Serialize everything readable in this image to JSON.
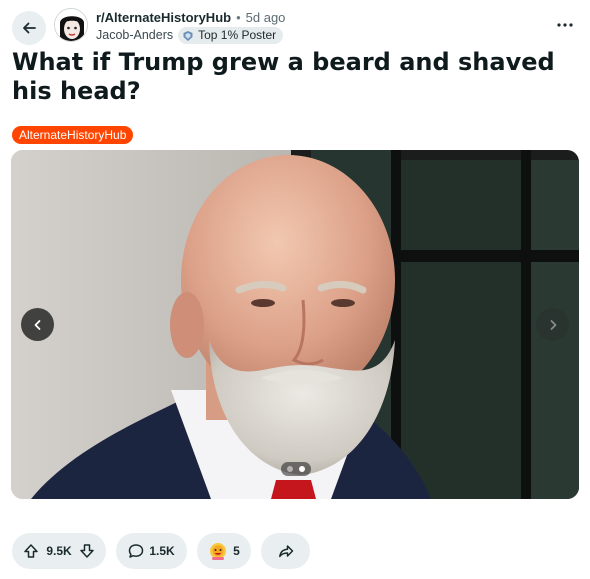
{
  "post": {
    "subreddit": "r/AlternateHistoryHub",
    "separator": "•",
    "age": "5d ago",
    "author": "Jacob-Anders",
    "author_flair": "Top 1% Poster",
    "title": "What if Trump grew a beard and shaved his head?",
    "tag": "AlternateHistoryHub",
    "tag_color": "#ff4500",
    "more_icon": "more-horizontal-icon",
    "back_icon": "arrow-left-icon"
  },
  "gallery": {
    "current_index": 2,
    "total": 2,
    "prev_icon": "chevron-left-icon",
    "next_icon": "chevron-right-icon"
  },
  "actions": {
    "score": "9.5K",
    "comments": "1.5K",
    "awards": "5",
    "upvote_icon": "arrow-up-icon",
    "downvote_icon": "arrow-down-icon",
    "comment_icon": "comment-bubble-icon",
    "award_icon": "award-medal-icon",
    "share_icon": "share-arrow-icon"
  }
}
